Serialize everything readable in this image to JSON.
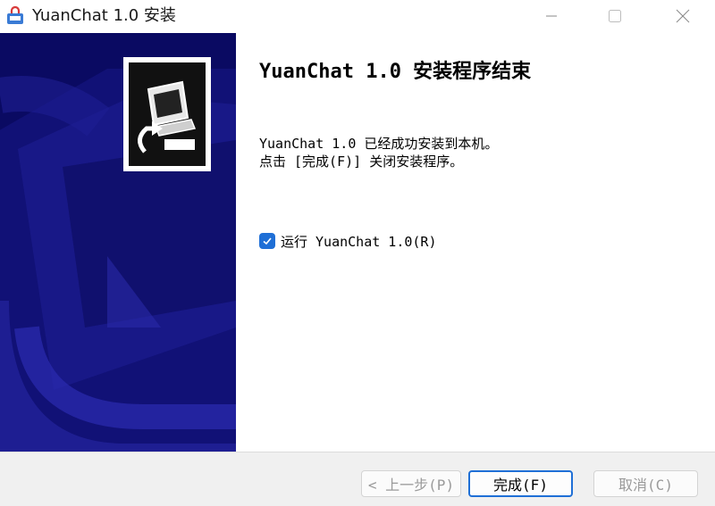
{
  "window": {
    "title": "YuanChat 1.0 安装",
    "icon": "installer-package-icon"
  },
  "banner": {
    "logo_icon": "computer-install-icon",
    "background": "#0a0a62"
  },
  "content": {
    "heading": "YuanChat 1.0 安装程序结束",
    "message_line1": "YuanChat 1.0 已经成功安装到本机。",
    "message_line2": "点击 [完成(F)] 关闭安装程序。",
    "run_checkbox": {
      "label": "运行 YuanChat 1.0(R)",
      "checked": true
    }
  },
  "buttons": {
    "back_label": "< 上一步(P)",
    "finish_label": "完成(F)",
    "cancel_label": "取消(C)"
  },
  "colors": {
    "accent": "#1f6fd6",
    "banner": "#0a0a62"
  }
}
